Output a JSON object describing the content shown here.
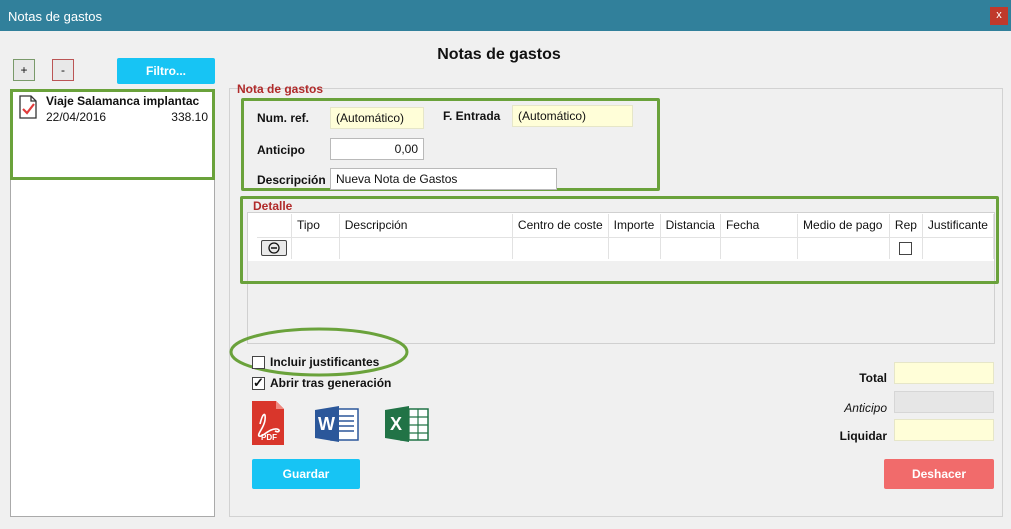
{
  "window": {
    "title": "Notas de gastos",
    "close_label": "x"
  },
  "page": {
    "heading": "Notas de gastos"
  },
  "toolbar": {
    "add_label": "+",
    "remove_label": "-",
    "filter_label": "Filtro..."
  },
  "list": {
    "items": [
      {
        "title": "Viaje Salamanca implantac",
        "date": "22/04/2016",
        "amount": "338.10"
      }
    ]
  },
  "header_section": {
    "title": "Nota de gastos",
    "num_ref_label": "Num. ref.",
    "num_ref_value": "(Automático)",
    "fecha_label": "F. Entrada",
    "fecha_value": "(Automático)",
    "anticipo_label": "Anticipo",
    "anticipo_value": "0,00",
    "descripcion_label": "Descripción",
    "descripcion_value": "Nueva Nota de Gastos"
  },
  "detail": {
    "title": "Detalle",
    "columns": [
      "Tipo",
      "Descripción",
      "Centro de coste",
      "Importe",
      "Distancia",
      "Fecha",
      "Medio de pago",
      "Rep",
      "Justificante"
    ]
  },
  "options": {
    "incluir_label": "Incluir justificantes",
    "incluir_checked": false,
    "abrir_label": "Abrir tras generación",
    "abrir_checked": true
  },
  "exports": {
    "pdf_caption": "PDF",
    "word_letter": "W",
    "excel_letter": "X"
  },
  "totals": {
    "total_label": "Total",
    "total_value": "",
    "anticipo_label": "Anticipo",
    "anticipo_value": "",
    "liquidar_label": "Liquidar",
    "liquidar_value": ""
  },
  "actions": {
    "save_label": "Guardar",
    "undo_label": "Deshacer"
  },
  "colors": {
    "titlebar": "#31809b",
    "accent_blue": "#17c4f4",
    "accent_red": "#f16b6b",
    "highlight_green": "#6aa23b",
    "section_red": "#b02a2a"
  }
}
